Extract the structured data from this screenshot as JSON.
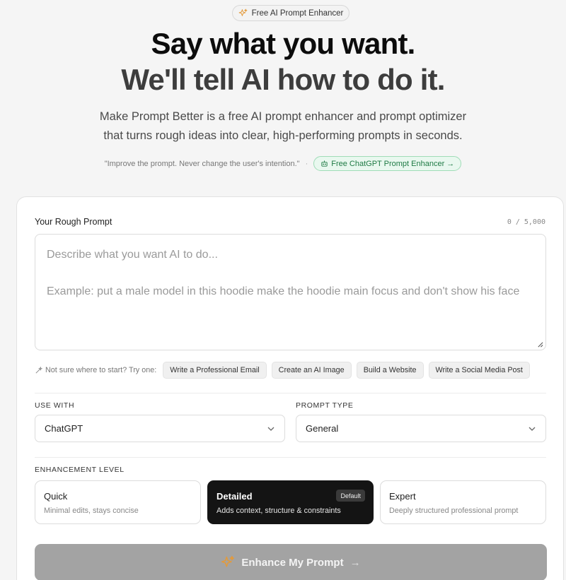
{
  "hero": {
    "badge_label": "Free AI Prompt Enhancer",
    "headline_line1": "Say what you want.",
    "headline_line2": "We'll tell AI how to do it.",
    "subtitle_line1": "Make Prompt Better is a free AI prompt enhancer and prompt optimizer",
    "subtitle_line2": "that turns rough ideas into clear, high-performing prompts in seconds.",
    "quote": "\"Improve the prompt. Never change the user's intention.\"",
    "separator": "·",
    "link_label": "Free ChatGPT Prompt Enhancer →"
  },
  "prompt": {
    "label": "Your Rough Prompt",
    "counter": "0 / 5,000",
    "placeholder_line1": "Describe what you want AI to do...",
    "placeholder_line2": "Example: put a male model in this hoodie make the hoodie main focus and don't show his face"
  },
  "suggestions": {
    "hint": "Not sure where to start? Try one:",
    "chips": [
      "Write a Professional Email",
      "Create an AI Image",
      "Build a Website",
      "Write a Social Media Post"
    ]
  },
  "use_with": {
    "label": "USE WITH",
    "value": "ChatGPT"
  },
  "prompt_type": {
    "label": "PROMPT TYPE",
    "value": "General"
  },
  "enhancement": {
    "label": "ENHANCEMENT LEVEL",
    "levels": [
      {
        "title": "Quick",
        "desc": "Minimal edits, stays concise"
      },
      {
        "title": "Detailed",
        "desc": "Adds context, structure & constraints",
        "badge": "Default"
      },
      {
        "title": "Expert",
        "desc": "Deeply structured professional prompt"
      }
    ],
    "selected": "Detailed"
  },
  "enhance_button": {
    "label": "Enhance My Prompt",
    "arrow": "→"
  },
  "colors": {
    "accent_orange": "#e39a3b",
    "green_pill": "#1e7a44",
    "active_card": "#141414",
    "button_disabled": "#a3a3a3"
  }
}
